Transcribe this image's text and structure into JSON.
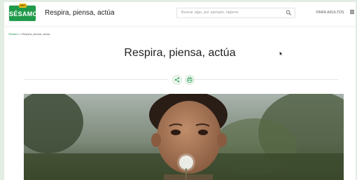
{
  "header": {
    "logo_badge": "ABC",
    "logo_text": "SÉSAMO",
    "site_title": "Respira, piensa, actúa",
    "search_placeholder": "Buscar algo, por ejemplo, higiene",
    "adults_link": "PARA ADULTOS"
  },
  "breadcrumb": {
    "home": "Sésamo",
    "separator": ">",
    "current": "Respira, piensa, actúa"
  },
  "article": {
    "title": "Respira, piensa, actúa"
  },
  "icons": {
    "search": "search-icon",
    "menu": "hamburger-menu-icon",
    "share": "share-icon",
    "print": "print-icon"
  },
  "colors": {
    "brand_green": "#1f9a4a",
    "logo_yellow": "#f2c01a",
    "outer_background": "#e4ede3"
  }
}
